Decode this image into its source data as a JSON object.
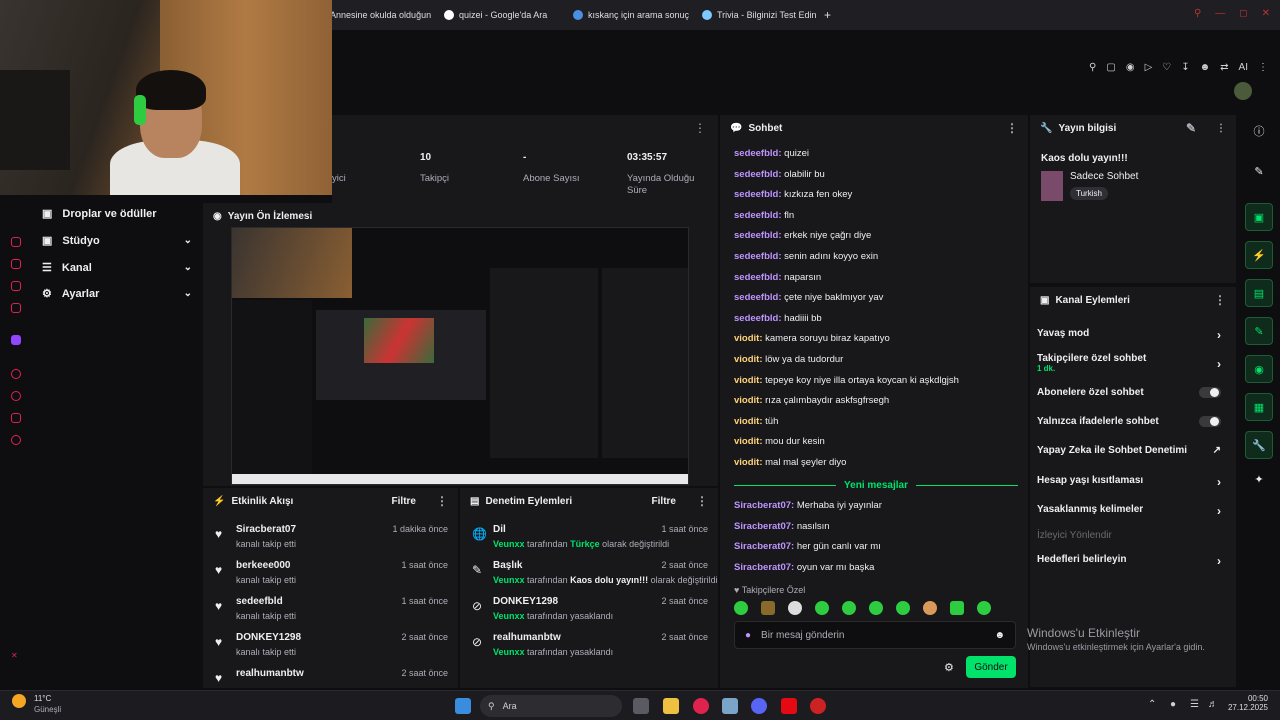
{
  "browser": {
    "tabs": [
      {
        "label": "Annesine okulda olduğun"
      },
      {
        "label": "quizei - Google'da Ara"
      },
      {
        "label": "kıskanç için arama sonuç"
      },
      {
        "label": "Trivia - Bilginizi Test Edin"
      }
    ],
    "new_tab": "+",
    "ai_label": "AI"
  },
  "nav": {
    "items": [
      {
        "label": "Droplar ve ödüller"
      },
      {
        "label": "Stüdyo"
      },
      {
        "label": "Kanal"
      },
      {
        "label": "Ayarlar"
      }
    ]
  },
  "stats": {
    "partial_label": "yici",
    "followers": {
      "value": "10",
      "label": "Takipçi"
    },
    "subs": {
      "value": "-",
      "label": "Abone Sayısı"
    },
    "uptime": {
      "value": "03:35:57",
      "label": "Yayında Olduğu Süre"
    }
  },
  "preview": {
    "title": "Yayın Ön İzlemesi"
  },
  "activity": {
    "title": "Etkinlik Akışı",
    "filter": "Filtre",
    "items": [
      {
        "name": "Siracberat07",
        "action": "kanalı takip etti",
        "time": "1 dakika önce"
      },
      {
        "name": "berkeee000",
        "action": "kanalı takip etti",
        "time": "1 saat önce"
      },
      {
        "name": "sedeefbld",
        "action": "kanalı takip etti",
        "time": "1 saat önce"
      },
      {
        "name": "DONKEY1298",
        "action": "kanalı takip etti",
        "time": "2 saat önce"
      },
      {
        "name": "realhumanbtw",
        "action": "",
        "time": "2 saat önce"
      }
    ]
  },
  "audit": {
    "title": "Denetim Eylemleri",
    "filter": "Filtre",
    "items": [
      {
        "name": "Dil",
        "actor": "Veunxx",
        "pre": "tarafından",
        "value": "Türkçe",
        "post": "olarak değiştirildi",
        "time": "1 saat önce"
      },
      {
        "name": "Başlık",
        "actor": "Veunxx",
        "pre": "tarafından",
        "value": "Kaos dolu yayın!!!",
        "post": "olarak değiştirildi",
        "time": "2 saat önce"
      },
      {
        "name": "DONKEY1298",
        "actor": "Veunxx",
        "pre": "tarafından yasaklandı",
        "value": "",
        "post": "",
        "time": "2 saat önce"
      },
      {
        "name": "realhumanbtw",
        "actor": "Veunxx",
        "pre": "tarafından yasaklandı",
        "value": "",
        "post": "",
        "time": "2 saat önce"
      }
    ]
  },
  "chat": {
    "title": "Sohbet",
    "messages": [
      {
        "user": "sedeefbld:",
        "text": "quizei",
        "color": "#bf94ff"
      },
      {
        "user": "sedeefbld:",
        "text": "olabilir bu",
        "color": "#bf94ff"
      },
      {
        "user": "sedeefbld:",
        "text": "kızkıza fen okey",
        "color": "#bf94ff"
      },
      {
        "user": "sedeefbld:",
        "text": "fln",
        "color": "#bf94ff"
      },
      {
        "user": "sedeefbld:",
        "text": "erkek niye çağrı diye",
        "color": "#bf94ff"
      },
      {
        "user": "sedeefbld:",
        "text": "senin adını koyyo exin",
        "color": "#bf94ff"
      },
      {
        "user": "sedeefbld:",
        "text": "naparsın",
        "color": "#bf94ff"
      },
      {
        "user": "sedeefbld:",
        "text": "çete niye baklmıyor yav",
        "color": "#bf94ff"
      },
      {
        "user": "sedeefbld:",
        "text": "hadiiii bb",
        "color": "#bf94ff"
      },
      {
        "user": "viodit:",
        "text": "kamera soruyu biraz kapatıyo",
        "color": "#ffd37a"
      },
      {
        "user": "viodit:",
        "text": "löw ya da tudordur",
        "color": "#ffd37a"
      },
      {
        "user": "viodit:",
        "text": "tepeye koy niye illa ortaya koycan ki aşkdlgjsh",
        "color": "#ffd37a"
      },
      {
        "user": "viodit:",
        "text": "rıza çalımbaydır askfsgfrsegh",
        "color": "#ffd37a"
      },
      {
        "user": "viodit:",
        "text": "tüh",
        "color": "#ffd37a"
      },
      {
        "user": "viodit:",
        "text": "mou dur kesin",
        "color": "#ffd37a"
      },
      {
        "user": "viodit:",
        "text": "mal mal şeyler diyo",
        "color": "#ffd37a"
      }
    ],
    "new_messages": "Yeni mesajlar",
    "new": [
      {
        "user": "Siracberat07:",
        "text": "Merhaba iyi yayınlar",
        "color": "#bf94ff"
      },
      {
        "user": "Siracberat07:",
        "text": "nasılsın",
        "color": "#bf94ff"
      },
      {
        "user": "Siracberat07:",
        "text": "her gün canlı var mı",
        "color": "#bf94ff"
      },
      {
        "user": "Siracberat07:",
        "text": "oyun var mı başka",
        "color": "#bf94ff"
      }
    ],
    "follower_only": "Takipçilere Özel",
    "input_placeholder": "Bir mesaj gönderin",
    "send": "Gönder"
  },
  "stream_info": {
    "title": "Yayın bilgisi",
    "stream_title": "Kaos dolu yayın!!!",
    "category": "Sadece Sohbet",
    "language": "Turkish"
  },
  "channel_actions": {
    "title": "Kanal Eylemleri",
    "items": [
      {
        "label": "Yavaş mod"
      },
      {
        "label": "Takipçilere özel sohbet",
        "sub": "1 dk."
      },
      {
        "label": "Abonelere özel sohbet"
      },
      {
        "label": "Yalnızca ifadelerle sohbet"
      },
      {
        "label": "Yapay Zeka ile Sohbet Denetimi"
      },
      {
        "label": "Hesap yaşı kısıtlaması"
      },
      {
        "label": "Yasaklanmış kelimeler"
      },
      {
        "label": "İzleyici Yönlendir"
      },
      {
        "label": "Hedefleri belirleyin"
      }
    ]
  },
  "windows": {
    "activate_title": "Windows'u Etkinleştir",
    "activate_sub": "Windows'u etkinleştirmek için Ayarlar'a gidin."
  },
  "taskbar": {
    "weather_temp": "11°C",
    "weather_desc": "Güneşli",
    "search": "Ara",
    "time": "00:50",
    "date": "27.12.2025"
  },
  "colors": {
    "accent": "#00e26a",
    "bg": "#0e0e10",
    "panel": "#18181b"
  }
}
